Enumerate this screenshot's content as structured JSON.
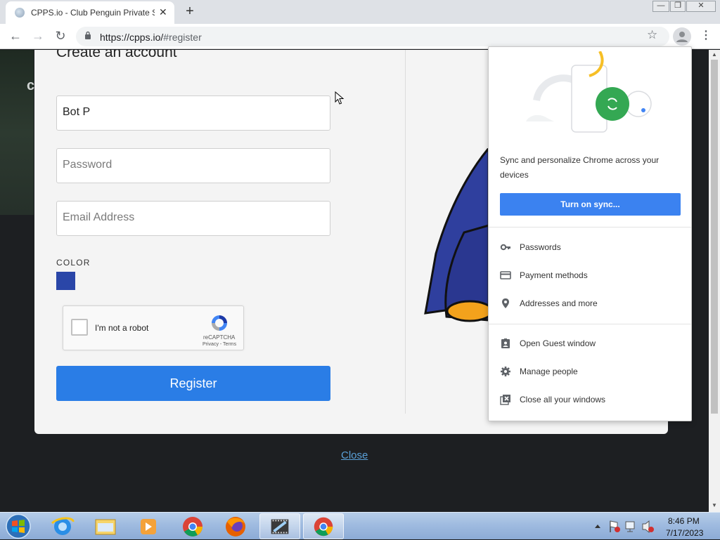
{
  "tab": {
    "title": "CPPS.io - Club Penguin Private Se",
    "close": "✕"
  },
  "new_tab": "+",
  "window_controls": {
    "minimize": "—",
    "restore": "❐",
    "close": "✕"
  },
  "toolbar": {
    "back": "←",
    "forward": "→",
    "reload": "↻",
    "url_host": "https://cpps.io/",
    "url_path": "#register",
    "star": "☆",
    "menu": "⋮"
  },
  "form": {
    "heading": "Create an account",
    "username_value": "Bot P",
    "password_placeholder": "Password",
    "email_placeholder": "Email Address",
    "color_label": "COLOR",
    "color_value": "#2a46a8",
    "recaptcha_label": "I'm not a robot",
    "recaptcha_brand": "reCAPTCHA",
    "recaptcha_terms": "Privacy - Terms",
    "register_label": "Register"
  },
  "close_link": "Close",
  "profile_menu": {
    "sync_text": "Sync and personalize Chrome across your devices",
    "sync_button": "Turn on sync...",
    "items_top": [
      {
        "label": "Passwords",
        "icon": "key-icon"
      },
      {
        "label": "Payment methods",
        "icon": "credit-card-icon"
      },
      {
        "label": "Addresses and more",
        "icon": "location-pin-icon"
      }
    ],
    "items_bottom": [
      {
        "label": "Open Guest window",
        "icon": "guest-icon"
      },
      {
        "label": "Manage people",
        "icon": "gear-icon"
      },
      {
        "label": "Close all your windows",
        "icon": "close-windows-icon"
      }
    ]
  },
  "taskbar": {
    "time": "8:46 PM",
    "date": "7/17/2023",
    "apps": [
      "internet-explorer-icon",
      "file-explorer-icon",
      "media-player-icon",
      "chrome-icon",
      "firefox-icon",
      "movie-maker-icon",
      "chrome-icon"
    ]
  },
  "colors": {
    "register_button": "#2a7de6",
    "sync_button": "#3b82f0",
    "page_background": "#1d1f22",
    "modal_background": "#f4f4f4"
  }
}
